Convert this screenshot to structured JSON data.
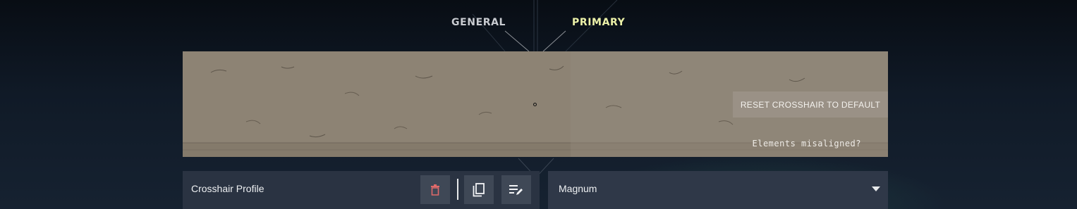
{
  "tabs": [
    {
      "label": "GENERAL",
      "active": false
    },
    {
      "label": "PRIMARY",
      "active": true
    }
  ],
  "preview": {
    "reset_label": "RESET CROSSHAIR TO DEFAULT",
    "misaligned_label": "Elements misaligned?"
  },
  "profile": {
    "label": "Crosshair Profile",
    "selected": "Magnum"
  },
  "colors": {
    "active_tab": "#ecf1a8",
    "inactive_tab": "#c9ccd1",
    "delete_icon": "#e06a6a",
    "panel": "#2a3342"
  },
  "icons": [
    "trash-icon",
    "copy-icon",
    "rename-icon",
    "caret-down-icon"
  ]
}
